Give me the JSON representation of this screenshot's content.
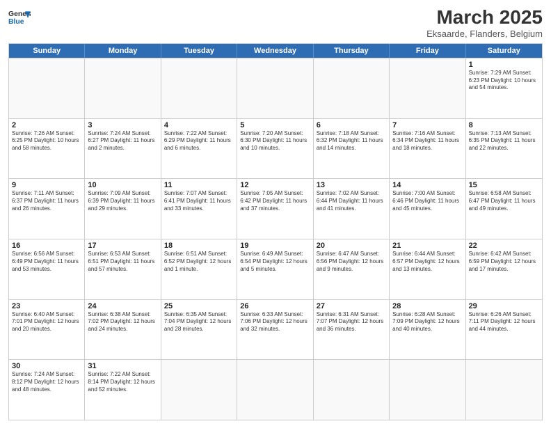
{
  "logo": {
    "text_general": "General",
    "text_blue": "Blue"
  },
  "title": {
    "month_year": "March 2025",
    "location": "Eksaarde, Flanders, Belgium"
  },
  "weekdays": [
    "Sunday",
    "Monday",
    "Tuesday",
    "Wednesday",
    "Thursday",
    "Friday",
    "Saturday"
  ],
  "weeks": [
    [
      {
        "day": "",
        "info": ""
      },
      {
        "day": "",
        "info": ""
      },
      {
        "day": "",
        "info": ""
      },
      {
        "day": "",
        "info": ""
      },
      {
        "day": "",
        "info": ""
      },
      {
        "day": "",
        "info": ""
      },
      {
        "day": "1",
        "info": "Sunrise: 7:29 AM\nSunset: 6:23 PM\nDaylight: 10 hours and 54 minutes."
      }
    ],
    [
      {
        "day": "2",
        "info": "Sunrise: 7:26 AM\nSunset: 6:25 PM\nDaylight: 10 hours and 58 minutes."
      },
      {
        "day": "3",
        "info": "Sunrise: 7:24 AM\nSunset: 6:27 PM\nDaylight: 11 hours and 2 minutes."
      },
      {
        "day": "4",
        "info": "Sunrise: 7:22 AM\nSunset: 6:29 PM\nDaylight: 11 hours and 6 minutes."
      },
      {
        "day": "5",
        "info": "Sunrise: 7:20 AM\nSunset: 6:30 PM\nDaylight: 11 hours and 10 minutes."
      },
      {
        "day": "6",
        "info": "Sunrise: 7:18 AM\nSunset: 6:32 PM\nDaylight: 11 hours and 14 minutes."
      },
      {
        "day": "7",
        "info": "Sunrise: 7:16 AM\nSunset: 6:34 PM\nDaylight: 11 hours and 18 minutes."
      },
      {
        "day": "8",
        "info": "Sunrise: 7:13 AM\nSunset: 6:35 PM\nDaylight: 11 hours and 22 minutes."
      }
    ],
    [
      {
        "day": "9",
        "info": "Sunrise: 7:11 AM\nSunset: 6:37 PM\nDaylight: 11 hours and 26 minutes."
      },
      {
        "day": "10",
        "info": "Sunrise: 7:09 AM\nSunset: 6:39 PM\nDaylight: 11 hours and 29 minutes."
      },
      {
        "day": "11",
        "info": "Sunrise: 7:07 AM\nSunset: 6:41 PM\nDaylight: 11 hours and 33 minutes."
      },
      {
        "day": "12",
        "info": "Sunrise: 7:05 AM\nSunset: 6:42 PM\nDaylight: 11 hours and 37 minutes."
      },
      {
        "day": "13",
        "info": "Sunrise: 7:02 AM\nSunset: 6:44 PM\nDaylight: 11 hours and 41 minutes."
      },
      {
        "day": "14",
        "info": "Sunrise: 7:00 AM\nSunset: 6:46 PM\nDaylight: 11 hours and 45 minutes."
      },
      {
        "day": "15",
        "info": "Sunrise: 6:58 AM\nSunset: 6:47 PM\nDaylight: 11 hours and 49 minutes."
      }
    ],
    [
      {
        "day": "16",
        "info": "Sunrise: 6:56 AM\nSunset: 6:49 PM\nDaylight: 11 hours and 53 minutes."
      },
      {
        "day": "17",
        "info": "Sunrise: 6:53 AM\nSunset: 6:51 PM\nDaylight: 11 hours and 57 minutes."
      },
      {
        "day": "18",
        "info": "Sunrise: 6:51 AM\nSunset: 6:52 PM\nDaylight: 12 hours and 1 minute."
      },
      {
        "day": "19",
        "info": "Sunrise: 6:49 AM\nSunset: 6:54 PM\nDaylight: 12 hours and 5 minutes."
      },
      {
        "day": "20",
        "info": "Sunrise: 6:47 AM\nSunset: 6:56 PM\nDaylight: 12 hours and 9 minutes."
      },
      {
        "day": "21",
        "info": "Sunrise: 6:44 AM\nSunset: 6:57 PM\nDaylight: 12 hours and 13 minutes."
      },
      {
        "day": "22",
        "info": "Sunrise: 6:42 AM\nSunset: 6:59 PM\nDaylight: 12 hours and 17 minutes."
      }
    ],
    [
      {
        "day": "23",
        "info": "Sunrise: 6:40 AM\nSunset: 7:01 PM\nDaylight: 12 hours and 20 minutes."
      },
      {
        "day": "24",
        "info": "Sunrise: 6:38 AM\nSunset: 7:02 PM\nDaylight: 12 hours and 24 minutes."
      },
      {
        "day": "25",
        "info": "Sunrise: 6:35 AM\nSunset: 7:04 PM\nDaylight: 12 hours and 28 minutes."
      },
      {
        "day": "26",
        "info": "Sunrise: 6:33 AM\nSunset: 7:06 PM\nDaylight: 12 hours and 32 minutes."
      },
      {
        "day": "27",
        "info": "Sunrise: 6:31 AM\nSunset: 7:07 PM\nDaylight: 12 hours and 36 minutes."
      },
      {
        "day": "28",
        "info": "Sunrise: 6:28 AM\nSunset: 7:09 PM\nDaylight: 12 hours and 40 minutes."
      },
      {
        "day": "29",
        "info": "Sunrise: 6:26 AM\nSunset: 7:11 PM\nDaylight: 12 hours and 44 minutes."
      }
    ],
    [
      {
        "day": "30",
        "info": "Sunrise: 7:24 AM\nSunset: 8:12 PM\nDaylight: 12 hours and 48 minutes."
      },
      {
        "day": "31",
        "info": "Sunrise: 7:22 AM\nSunset: 8:14 PM\nDaylight: 12 hours and 52 minutes."
      },
      {
        "day": "",
        "info": ""
      },
      {
        "day": "",
        "info": ""
      },
      {
        "day": "",
        "info": ""
      },
      {
        "day": "",
        "info": ""
      },
      {
        "day": "",
        "info": ""
      }
    ]
  ]
}
